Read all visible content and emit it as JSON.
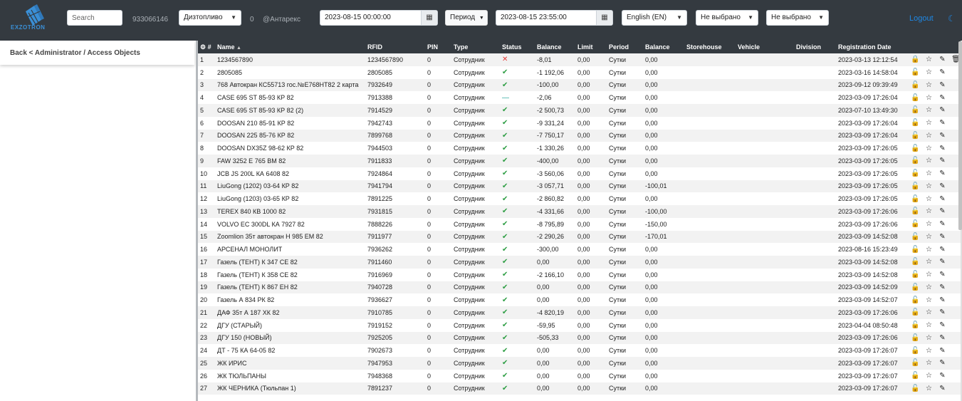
{
  "brand": {
    "logo_text": "EXZOTRON"
  },
  "top": {
    "search_placeholder": "Search",
    "number": "933066146",
    "fuel_select": "Дизтопливо",
    "count": "0",
    "company": "@Антарекс",
    "date_from": "2023-08-15 00:00:00",
    "period_label": "Период",
    "date_to": "2023-08-15 23:55:00",
    "language": "English (EN)",
    "filter1": "Не выбрано",
    "filter2": "Не выбрано",
    "logout": "Logout"
  },
  "breadcrumb": "Back < Administrator / Access Objects",
  "colors": {
    "topbar": "#343a40",
    "accent": "#1e88e5",
    "ok": "#2e9e44",
    "error": "#e53935"
  },
  "table": {
    "columns": [
      "#",
      "Name",
      "RFID",
      "PIN",
      "Type",
      "Status",
      "Balance",
      "Limit",
      "Period",
      "Balance",
      "Storehouse",
      "Vehicle",
      "Division",
      "Registration Date"
    ],
    "rows": [
      {
        "n": "1",
        "name": "1234567890",
        "rfid": "1234567890",
        "pin": "0",
        "type": "Сотрудник",
        "status": "blocked",
        "bal": "-8,01",
        "limit": "0,00",
        "period": "Сутки",
        "bal2": "0,00",
        "date": "2023-03-13 12:12:54",
        "lock": "locked"
      },
      {
        "n": "2",
        "name": "2805085",
        "rfid": "2805085",
        "pin": "0",
        "type": "Сотрудник",
        "status": "ok",
        "bal": "-1 192,06",
        "limit": "0,00",
        "period": "Сутки",
        "bal2": "0,00",
        "date": "2023-03-16 14:58:04"
      },
      {
        "n": "3",
        "name": "768 Автокран КС55713 гос.№Е768НТ82 2 карта",
        "rfid": "7932649",
        "pin": "0",
        "type": "Сотрудник",
        "status": "ok",
        "bal": "-100,00",
        "limit": "0,00",
        "period": "Сутки",
        "bal2": "0,00",
        "date": "2023-09-12 09:39:49"
      },
      {
        "n": "4",
        "name": "CASE 695 ST 85-93 КР 82",
        "rfid": "7913388",
        "pin": "0",
        "type": "Сотрудник",
        "status": "pending",
        "bal": "-2,06",
        "limit": "0,00",
        "period": "Сутки",
        "bal2": "0,00",
        "date": "2023-03-09 17:26:04"
      },
      {
        "n": "5",
        "name": "CASE 695 ST 85-93 КР 82 (2)",
        "rfid": "7914529",
        "pin": "0",
        "type": "Сотрудник",
        "status": "ok",
        "bal": "-2 500,73",
        "limit": "0,00",
        "period": "Сутки",
        "bal2": "0,00",
        "date": "2023-07-10 13:49:30"
      },
      {
        "n": "6",
        "name": "DOOSAN 210 85-91 КР 82",
        "rfid": "7942743",
        "pin": "0",
        "type": "Сотрудник",
        "status": "ok",
        "bal": "-9 331,24",
        "limit": "0,00",
        "period": "Сутки",
        "bal2": "0,00",
        "date": "2023-03-09 17:26:04"
      },
      {
        "n": "7",
        "name": "DOOSAN 225 85-76 КР 82",
        "rfid": "7899768",
        "pin": "0",
        "type": "Сотрудник",
        "status": "ok",
        "bal": "-7 750,17",
        "limit": "0,00",
        "period": "Сутки",
        "bal2": "0,00",
        "date": "2023-03-09 17:26:04"
      },
      {
        "n": "8",
        "name": "DOOSAN DX35Z 98-62 КР 82",
        "rfid": "7944503",
        "pin": "0",
        "type": "Сотрудник",
        "status": "ok",
        "bal": "-1 330,26",
        "limit": "0,00",
        "period": "Сутки",
        "bal2": "0,00",
        "date": "2023-03-09 17:26:05"
      },
      {
        "n": "9",
        "name": "FAW 3252 Е 765 ВМ 82",
        "rfid": "7911833",
        "pin": "0",
        "type": "Сотрудник",
        "status": "ok",
        "bal": "-400,00",
        "limit": "0,00",
        "period": "Сутки",
        "bal2": "0,00",
        "date": "2023-03-09 17:26:05"
      },
      {
        "n": "10",
        "name": "JCB JS 200L КА 6408 82",
        "rfid": "7924864",
        "pin": "0",
        "type": "Сотрудник",
        "status": "ok",
        "bal": "-3 560,06",
        "limit": "0,00",
        "period": "Сутки",
        "bal2": "0,00",
        "date": "2023-03-09 17:26:05"
      },
      {
        "n": "11",
        "name": "LiuGong (1202) 03-64 КР 82",
        "rfid": "7941794",
        "pin": "0",
        "type": "Сотрудник",
        "status": "ok",
        "bal": "-3 057,71",
        "limit": "0,00",
        "period": "Сутки",
        "bal2": "-100,01",
        "date": "2023-03-09 17:26:05"
      },
      {
        "n": "12",
        "name": "LiuGong (1203) 03-65 КР 82",
        "rfid": "7891225",
        "pin": "0",
        "type": "Сотрудник",
        "status": "ok",
        "bal": "-2 860,82",
        "limit": "0,00",
        "period": "Сутки",
        "bal2": "0,00",
        "date": "2023-03-09 17:26:05"
      },
      {
        "n": "13",
        "name": "TEREX 840 КВ 1000 82",
        "rfid": "7931815",
        "pin": "0",
        "type": "Сотрудник",
        "status": "ok",
        "bal": "-4 331,66",
        "limit": "0,00",
        "period": "Сутки",
        "bal2": "-100,00",
        "date": "2023-03-09 17:26:06"
      },
      {
        "n": "14",
        "name": "VOLVO EC 300DL КА 7927 82",
        "rfid": "7888226",
        "pin": "0",
        "type": "Сотрудник",
        "status": "ok",
        "bal": "-8 795,89",
        "limit": "0,00",
        "period": "Сутки",
        "bal2": "-150,00",
        "date": "2023-03-09 17:26:06"
      },
      {
        "n": "15",
        "name": "Zoomlion 35т автокран Н 985 ЕМ 82",
        "rfid": "7911977",
        "pin": "0",
        "type": "Сотрудник",
        "status": "ok",
        "bal": "-2 290,26",
        "limit": "0,00",
        "period": "Сутки",
        "bal2": "-170,01",
        "date": "2023-03-09 14:52:08"
      },
      {
        "n": "16",
        "name": "АРСЕНАЛ МОНОЛИТ",
        "rfid": "7936262",
        "pin": "0",
        "type": "Сотрудник",
        "status": "ok",
        "bal": "-300,00",
        "limit": "0,00",
        "period": "Сутки",
        "bal2": "0,00",
        "date": "2023-08-16 15:23:49"
      },
      {
        "n": "17",
        "name": "Газель (ТЕНТ) К 347 СЕ 82",
        "rfid": "7911460",
        "pin": "0",
        "type": "Сотрудник",
        "status": "ok",
        "bal": "0,00",
        "limit": "0,00",
        "period": "Сутки",
        "bal2": "0,00",
        "date": "2023-03-09 14:52:08"
      },
      {
        "n": "18",
        "name": "Газель (ТЕНТ) К 358 СЕ 82",
        "rfid": "7916969",
        "pin": "0",
        "type": "Сотрудник",
        "status": "ok",
        "bal": "-2 166,10",
        "limit": "0,00",
        "period": "Сутки",
        "bal2": "0,00",
        "date": "2023-03-09 14:52:08"
      },
      {
        "n": "19",
        "name": "Газель (ТЕНТ) К 867 ЕН 82",
        "rfid": "7940728",
        "pin": "0",
        "type": "Сотрудник",
        "status": "ok",
        "bal": "0,00",
        "limit": "0,00",
        "period": "Сутки",
        "bal2": "0,00",
        "date": "2023-03-09 14:52:09"
      },
      {
        "n": "20",
        "name": "Газель А 834 РК 82",
        "rfid": "7936627",
        "pin": "0",
        "type": "Сотрудник",
        "status": "ok",
        "bal": "0,00",
        "limit": "0,00",
        "period": "Сутки",
        "bal2": "0,00",
        "date": "2023-03-09 14:52:07"
      },
      {
        "n": "21",
        "name": "ДАФ 35т А 187 ХК 82",
        "rfid": "7910785",
        "pin": "0",
        "type": "Сотрудник",
        "status": "ok",
        "bal": "-4 820,19",
        "limit": "0,00",
        "period": "Сутки",
        "bal2": "0,00",
        "date": "2023-03-09 17:26:06"
      },
      {
        "n": "22",
        "name": "ДГУ (СТАРЫЙ)",
        "rfid": "7919152",
        "pin": "0",
        "type": "Сотрудник",
        "status": "ok",
        "bal": "-59,95",
        "limit": "0,00",
        "period": "Сутки",
        "bal2": "0,00",
        "date": "2023-04-04 08:50:48"
      },
      {
        "n": "23",
        "name": "ДГУ 150 (НОВЫЙ)",
        "rfid": "7925205",
        "pin": "0",
        "type": "Сотрудник",
        "status": "ok",
        "bal": "-505,33",
        "limit": "0,00",
        "period": "Сутки",
        "bal2": "0,00",
        "date": "2023-03-09 17:26:06"
      },
      {
        "n": "24",
        "name": "ДТ - 75 КА 64-05 82",
        "rfid": "7902673",
        "pin": "0",
        "type": "Сотрудник",
        "status": "ok",
        "bal": "0,00",
        "limit": "0,00",
        "period": "Сутки",
        "bal2": "0,00",
        "date": "2023-03-09 17:26:07"
      },
      {
        "n": "25",
        "name": "ЖК ИРИС",
        "rfid": "7947953",
        "pin": "0",
        "type": "Сотрудник",
        "status": "ok",
        "bal": "0,00",
        "limit": "0,00",
        "period": "Сутки",
        "bal2": "0,00",
        "date": "2023-03-09 17:26:07"
      },
      {
        "n": "26",
        "name": "ЖК ТЮЛЬПАНЫ",
        "rfid": "7948368",
        "pin": "0",
        "type": "Сотрудник",
        "status": "ok",
        "bal": "0,00",
        "limit": "0,00",
        "period": "Сутки",
        "bal2": "0,00",
        "date": "2023-03-09 17:26:07"
      },
      {
        "n": "27",
        "name": "ЖК ЧЕРНИКА (Тюльпан 1)",
        "rfid": "7891237",
        "pin": "0",
        "type": "Сотрудник",
        "status": "ok",
        "bal": "0,00",
        "limit": "0,00",
        "period": "Сутки",
        "bal2": "0,00",
        "date": "2023-03-09 17:26:07"
      }
    ]
  }
}
